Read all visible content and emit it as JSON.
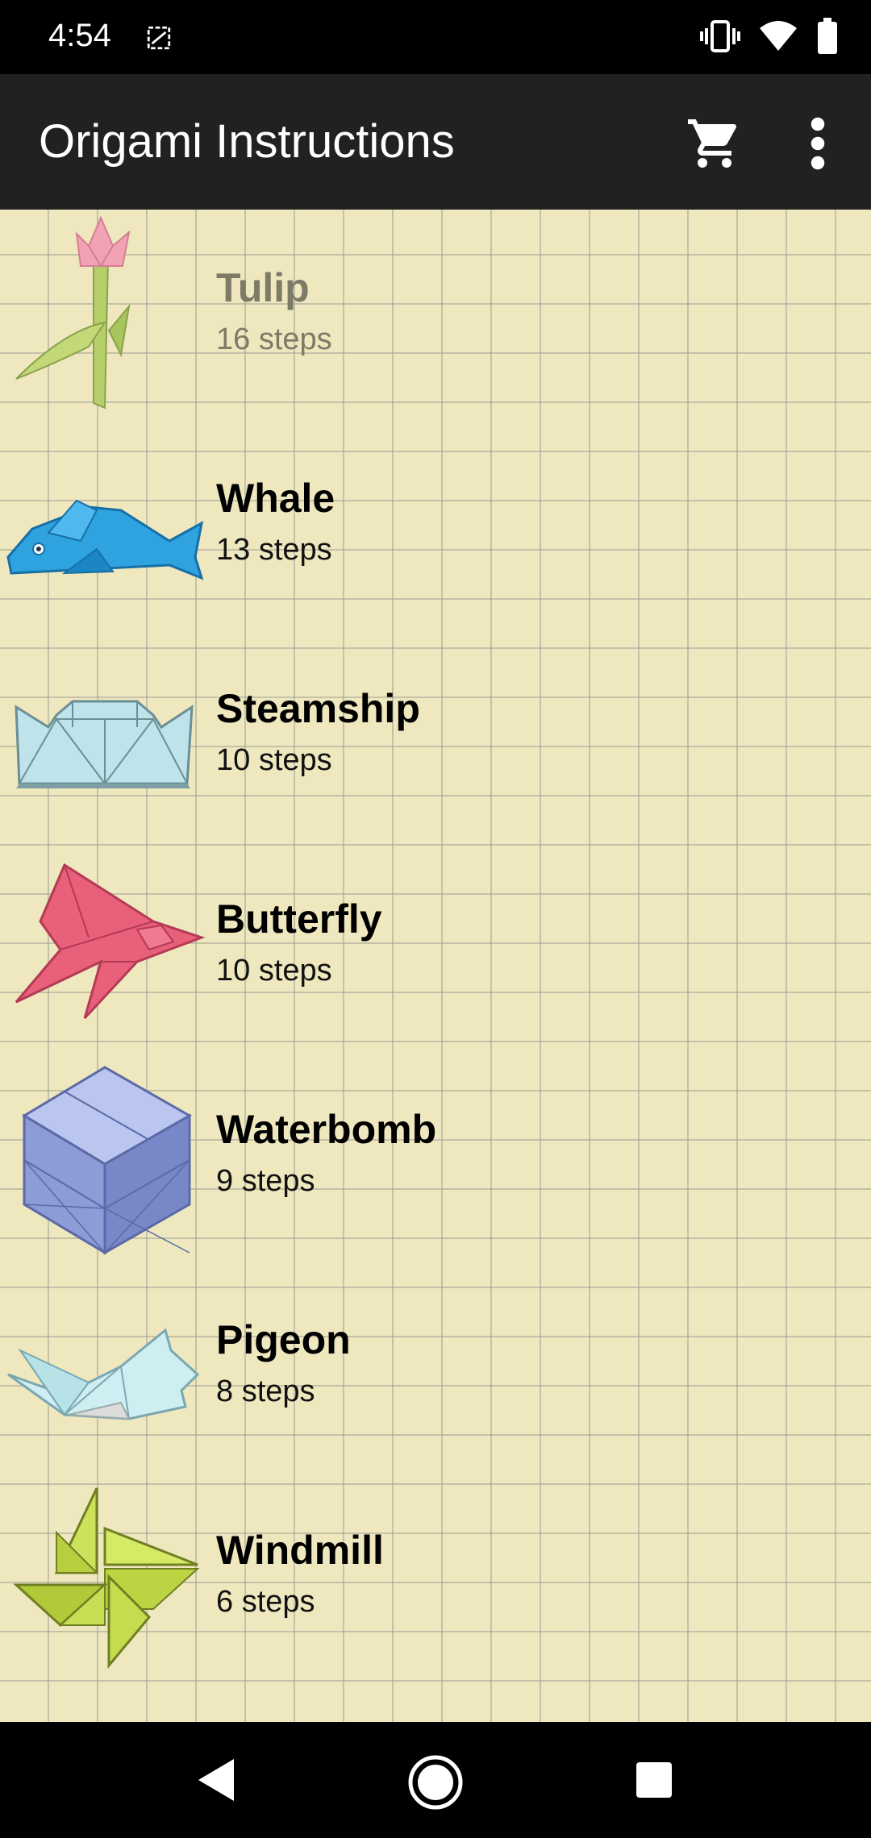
{
  "status_bar": {
    "time": "4:54",
    "icons": [
      "image-notification-icon",
      "vibrate-icon",
      "wifi-icon",
      "battery-icon"
    ]
  },
  "app_bar": {
    "title": "Origami Instructions",
    "actions": [
      "cart-icon",
      "more-vert-icon"
    ]
  },
  "items": [
    {
      "title": "Tulip",
      "steps": "16 steps",
      "icon": "tulip-icon"
    },
    {
      "title": "Whale",
      "steps": "13 steps",
      "icon": "whale-icon"
    },
    {
      "title": "Steamship",
      "steps": "10 steps",
      "icon": "steamship-icon"
    },
    {
      "title": "Butterfly",
      "steps": "10 steps",
      "icon": "butterfly-icon"
    },
    {
      "title": "Waterbomb",
      "steps": "9 steps",
      "icon": "waterbomb-icon"
    },
    {
      "title": "Pigeon",
      "steps": "8 steps",
      "icon": "pigeon-icon"
    },
    {
      "title": "Windmill",
      "steps": "6 steps",
      "icon": "windmill-icon"
    }
  ],
  "colors": {
    "app_bar": "#212121",
    "paper": "#efe8bf",
    "grid_line": "#a0a096"
  },
  "nav_bar": {
    "buttons": [
      "back-icon",
      "home-icon",
      "recents-icon"
    ]
  }
}
